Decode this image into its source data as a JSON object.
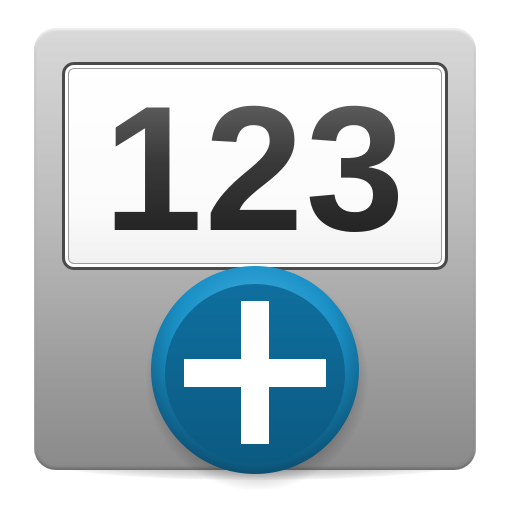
{
  "counter": {
    "value": "123"
  },
  "add_button": {
    "icon": "plus-icon"
  },
  "colors": {
    "tile_top": "#d9d9d9",
    "tile_bottom": "#8a8a8a",
    "display_border": "#4a4a4a",
    "digits": "#2a2a2a",
    "button_blue": "#1a8fc4",
    "button_dark": "#0e5c82",
    "plus": "#ffffff"
  }
}
